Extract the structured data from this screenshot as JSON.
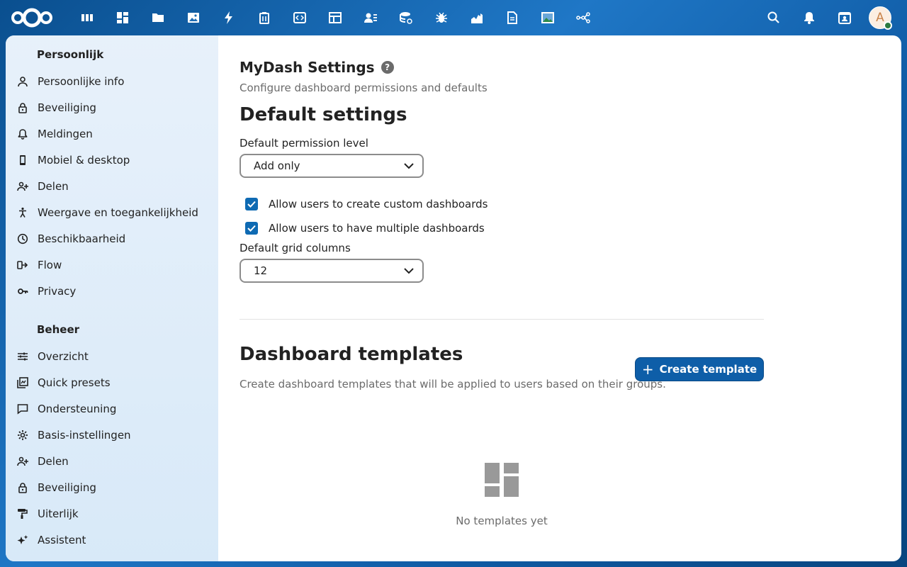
{
  "topbar": {
    "apps": [
      "dashboard-app-icon",
      "grid-app-icon",
      "files-icon",
      "photos-icon",
      "activity-icon",
      "deck-icon",
      "code-icon",
      "tables-icon",
      "contacts-icon",
      "data-icon",
      "bug-icon",
      "chart-icon",
      "document-icon",
      "image-icon",
      "flow-icon"
    ],
    "avatar_letter": "A"
  },
  "sidebar": {
    "personal_title": "Persoonlijk",
    "personal_items": [
      {
        "label": "Persoonlijke info",
        "icon": "person-icon"
      },
      {
        "label": "Beveiliging",
        "icon": "lock-icon"
      },
      {
        "label": "Meldingen",
        "icon": "bell-icon"
      },
      {
        "label": "Mobiel & desktop",
        "icon": "phone-icon"
      },
      {
        "label": "Delen",
        "icon": "share-icon"
      },
      {
        "label": "Weergave en toegankelijkheid",
        "icon": "accessibility-icon"
      },
      {
        "label": "Beschikbaarheid",
        "icon": "clock-icon"
      },
      {
        "label": "Flow",
        "icon": "flow-arrow-icon"
      },
      {
        "label": "Privacy",
        "icon": "key-icon"
      }
    ],
    "admin_title": "Beheer",
    "admin_items": [
      {
        "label": "Overzicht",
        "icon": "sliders-icon"
      },
      {
        "label": "Quick presets",
        "icon": "presets-icon"
      },
      {
        "label": "Ondersteuning",
        "icon": "chat-icon"
      },
      {
        "label": "Basis-instellingen",
        "icon": "gear-icon"
      },
      {
        "label": "Delen",
        "icon": "share-icon"
      },
      {
        "label": "Beveiliging",
        "icon": "lock-icon"
      },
      {
        "label": "Uiterlijk",
        "icon": "paint-roller-icon"
      },
      {
        "label": "Assistent",
        "icon": "sparkle-icon"
      }
    ]
  },
  "main": {
    "title": "MyDash Settings",
    "help": "?",
    "description": "Configure dashboard permissions and defaults",
    "default_title": "Default settings",
    "permission_label": "Default permission level",
    "permission_value": "Add only",
    "check_custom": "Allow users to create custom dashboards",
    "check_multiple": "Allow users to have multiple dashboards",
    "grid_label": "Default grid columns",
    "grid_value": "12",
    "templates_title": "Dashboard templates",
    "create_button": "Create template",
    "templates_description": "Create dashboard templates that will be applied to users based on their groups.",
    "empty_text": "No templates yet"
  }
}
